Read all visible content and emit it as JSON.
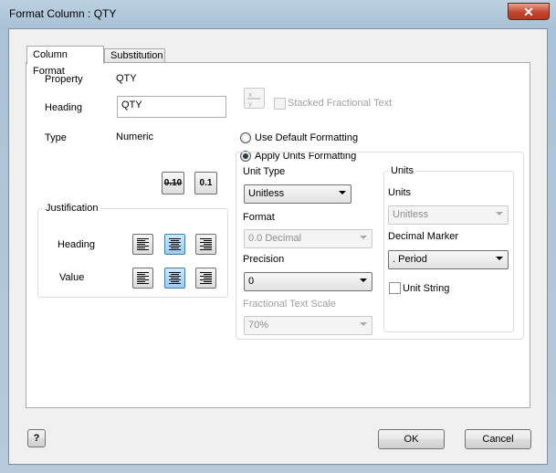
{
  "window": {
    "title": "Format Column : QTY",
    "close_glyph": "✕"
  },
  "tabs": [
    {
      "label": "Column Format"
    },
    {
      "label": "Substitution"
    }
  ],
  "form": {
    "property_label": "Property",
    "property_value": "QTY",
    "heading_label": "Heading",
    "heading_value": "QTY",
    "type_label": "Type",
    "type_value": "Numeric",
    "stacked_label": "Stacked Fractional Text",
    "precision_decrease_label": "0.10",
    "precision_increase_label": "0.1"
  },
  "justification": {
    "title": "Justification",
    "heading_label": "Heading",
    "value_label": "Value",
    "heading_selected": "center",
    "value_selected": "center"
  },
  "formatting": {
    "use_default_label": "Use Default Formatting",
    "apply_units_label": "Apply Units Formatting",
    "unit_type_label": "Unit Type",
    "unit_type_value": "Unitless",
    "format_label": "Format",
    "format_value": "0.0 Decimal",
    "precision_label": "Precision",
    "precision_value": "0",
    "fractional_scale_label": "Fractional Text Scale",
    "fractional_scale_value": "70%"
  },
  "units_group": {
    "title": "Units",
    "units_label": "Units",
    "units_value": "Unitless",
    "decimal_marker_label": "Decimal Marker",
    "decimal_marker_value": ". Period",
    "unit_string_label": "Unit String"
  },
  "footer": {
    "help_glyph": "?",
    "ok_label": "OK",
    "cancel_label": "Cancel"
  }
}
